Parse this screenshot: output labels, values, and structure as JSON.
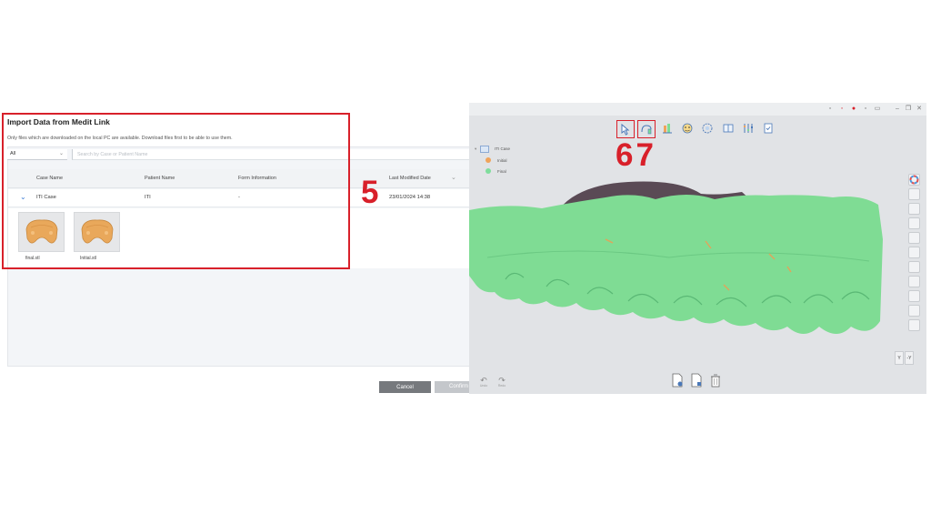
{
  "import_dialog": {
    "title": "Import Data from Medit Link",
    "subtitle": "Only files which are downloaded on the local PC are available. Download files first to be able to use them.",
    "filter": {
      "value": "All"
    },
    "search": {
      "placeholder": "Search by Case or Patient Name"
    },
    "columns": [
      "Case Name",
      "Patient Name",
      "Form Information",
      "Last Modified Date"
    ],
    "rows": [
      {
        "case_name": "ITI Case",
        "patient_name": "ITI",
        "form_information": "-",
        "last_modified": "23/01/2024 14:38"
      }
    ],
    "files": [
      {
        "name": "final.stl"
      },
      {
        "name": "Initial.stl"
      }
    ],
    "buttons": {
      "cancel": "Cancel",
      "confirm": "Confirm"
    }
  },
  "callouts": {
    "step5": "5",
    "step67": "67"
  },
  "viewer": {
    "tree": {
      "root": "ITI Case",
      "items": [
        {
          "label": "Initial",
          "color": "#f0a35a"
        },
        {
          "label": "Final",
          "color": "#7fdd9c"
        }
      ]
    },
    "undo_label": "Undo",
    "redo_label": "Redo",
    "view_toggle": [
      "Y",
      "-Y"
    ]
  },
  "colors": {
    "highlight": "#d8202a",
    "mesh_final": "#7fdc94",
    "mesh_initial": "#5a4a55",
    "model_thumb": "#e9a85b"
  }
}
